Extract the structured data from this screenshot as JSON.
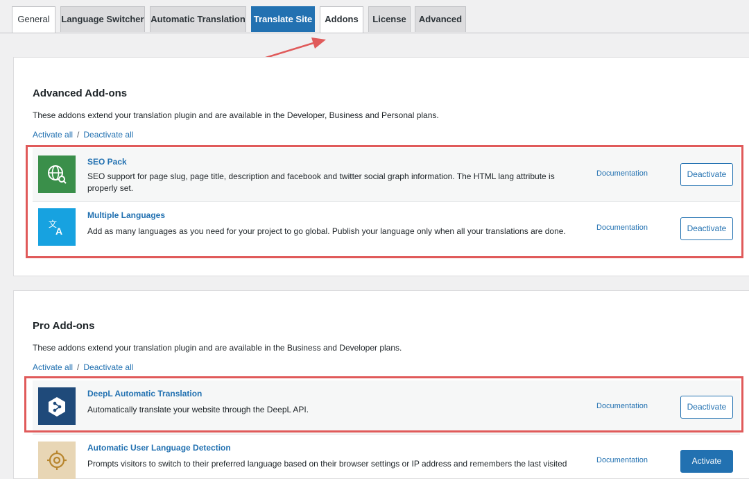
{
  "tabs": [
    {
      "label": "General"
    },
    {
      "label": "Language Switcher"
    },
    {
      "label": "Automatic Translation"
    },
    {
      "label": "Translate Site"
    },
    {
      "label": "Addons"
    },
    {
      "label": "License"
    },
    {
      "label": "Advanced"
    }
  ],
  "advanced": {
    "title": "Advanced Add-ons",
    "description": "These addons extend your translation plugin and are available in the Developer, Business and Personal plans.",
    "activate_all": "Activate all",
    "separator": "/",
    "deactivate_all": "Deactivate all",
    "addons": [
      {
        "name": "SEO Pack",
        "description": "SEO support for page slug, page title, description and facebook and twitter social graph information. The HTML lang attribute is properly set.",
        "doc": "Documentation",
        "button": "Deactivate",
        "icon": "globe-search-icon",
        "icon_bg": "#3a8f4a"
      },
      {
        "name": "Multiple Languages",
        "description": "Add as many languages as you need for your project to go global. Publish your language only when all your translations are done.",
        "doc": "Documentation",
        "button": "Deactivate",
        "icon": "translate-icon",
        "icon_bg": "#17a2e0"
      }
    ]
  },
  "pro": {
    "title": "Pro Add-ons",
    "description": "These addons extend your translation plugin and are available in the Business and Developer plans.",
    "activate_all": "Activate all",
    "separator": "/",
    "deactivate_all": "Deactivate all",
    "addons": [
      {
        "name": "DeepL Automatic Translation",
        "description": "Automatically translate your website through the DeepL API.",
        "doc": "Documentation",
        "button": "Deactivate",
        "icon": "deepl-icon",
        "icon_bg": "#1f4a7a"
      },
      {
        "name": "Automatic User Language Detection",
        "description": "Prompts visitors to switch to their preferred language based on their browser settings or IP address and remembers the last visited",
        "doc": "Documentation",
        "button": "Activate",
        "icon": "target-icon",
        "icon_bg": "#e8d6b5"
      }
    ]
  },
  "colors": {
    "accent": "#2271b1",
    "highlight": "#e05a5a"
  }
}
